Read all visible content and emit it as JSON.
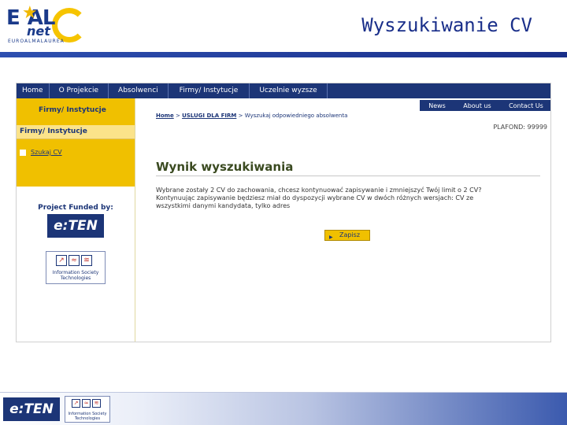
{
  "slide": {
    "logo_ea": "E",
    "logo_al": "AL",
    "logo_star": "★",
    "logo_net": "net",
    "logo_sub": "EUROALMALAUREA",
    "title": "Wyszukiwanie CV"
  },
  "navbar": {
    "items": [
      "Home",
      "O Projekcie",
      "Absolwenci",
      "Firmy/ Instytucje",
      "Uczelnie wyzsze"
    ]
  },
  "topnav": {
    "items": [
      "News",
      "About us",
      "Contact Us"
    ]
  },
  "sidebar": {
    "heading": "Firmy/ Instytucje",
    "subheading": "Firmy/ Instytucje",
    "link": "Szukaj CV",
    "funded_label": "Project Funded by:",
    "eten_logo": "e:TEN",
    "is_logo_text": "Information Society",
    "is_logo_sub": "Technologies"
  },
  "main": {
    "breadcrumb_home": "Home",
    "breadcrumb_sep1": ">",
    "breadcrumb_services": "USLUGI DLA FIRM",
    "breadcrumb_sep2": ">",
    "breadcrumb_current": "Wyszukaj odpowiedniego absolwenta",
    "plafond": "PLAFOND: 99999",
    "result_title": "Wynik wyszukiwania",
    "body_text": "Wybrane zostały 2 CV do zachowania, chcesz kontynuować zapisywanie i zmniejszyć Twój limit o 2 CV? Kontynuując zapisywanie będziesz miał do dyspozycji wybrane CV w dwóch różnych wersjach: CV ze wszystkimi danymi kandydata, tylko adres",
    "save_button": "Zapisz"
  },
  "footer": {
    "eten_logo": "e:TEN",
    "is_logo_text": "Information Society",
    "is_logo_sub": "Technologies"
  },
  "colors": {
    "nav_blue": "#1c3577",
    "accent_yellow": "#f0c000",
    "title_blue": "#1a2f8a"
  }
}
